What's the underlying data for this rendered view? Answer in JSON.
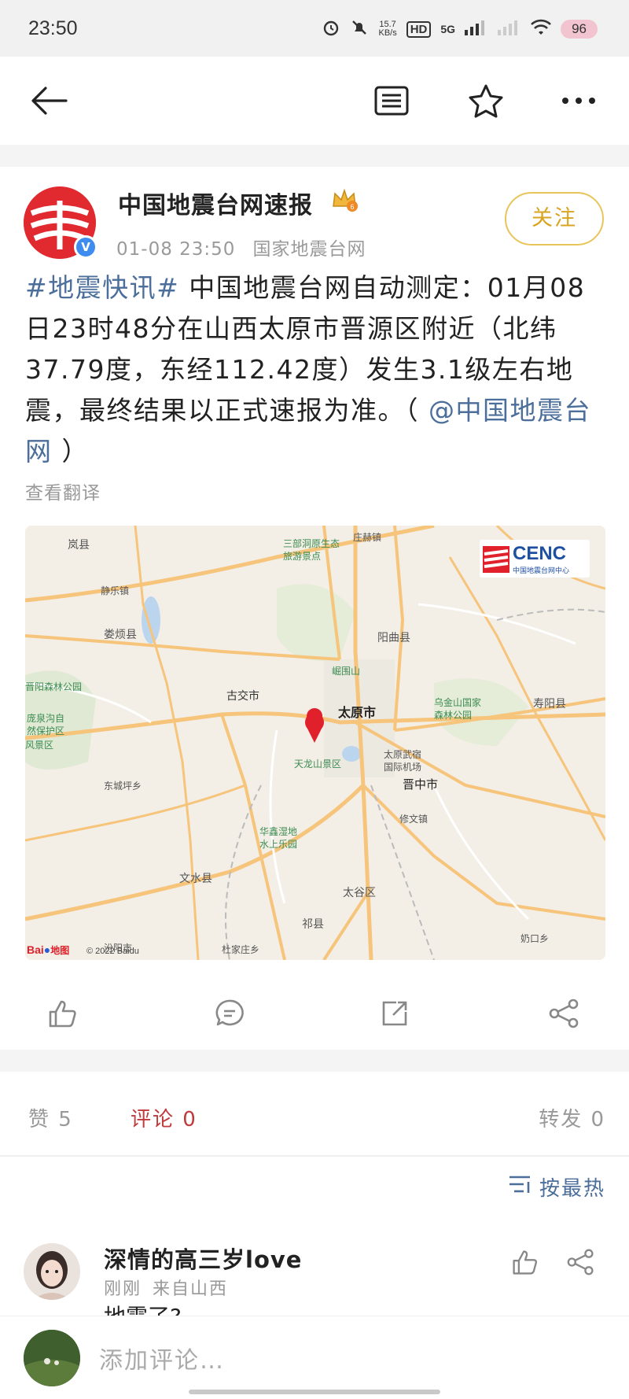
{
  "status_bar": {
    "time": "23:50",
    "net_speed_value": "15.7",
    "net_speed_unit": "KB/s",
    "hd_label": "HD",
    "hd_sub": "1",
    "network": "5G",
    "battery": "96",
    "icons": [
      "alarm-icon",
      "mute-icon",
      "signal-icon",
      "wifi-icon"
    ]
  },
  "nav": {
    "icons": [
      "back-arrow-icon",
      "article-list-icon",
      "star-icon",
      "more-icon"
    ]
  },
  "post": {
    "author": "中国地震台网速报",
    "time": "01-08 23:50",
    "source": "国家地震台网",
    "follow_label": "关注",
    "hashtag": "#地震快讯#",
    "body": " 中国地震台网自动测定：01月08日23时48分在山西太原市晋源区附近（北纬37.79度，东经112.42度）发生3.1级左右地震，最终结果以正式速报为准。（ ",
    "mention": "@中国地震台网",
    "body_end": " ）",
    "translate": "查看翻译"
  },
  "map": {
    "logo_text": "CENC",
    "logo_sub": "中国地震台网中心",
    "copyright": "© 2022 Baidu",
    "baidu_text": "Bai",
    "baidu_sub": "地图",
    "labels": {
      "lanxian": "岚县",
      "sanbu": "三部洞原生态",
      "sanbu2": "旅游景点",
      "zhuang": "庄赫镇",
      "jingle": "静乐镇",
      "loufan": "娄烦县",
      "yangqu": "阳曲县",
      "zhuoshan": "晋阳森林公园",
      "gujiaoshi": "古交市",
      "gushan": "崛围山",
      "taiyuan": "太原市",
      "wujin": "乌金山国家",
      "wujin2": "森林公园",
      "shouyang": "寿阳县",
      "pangquan": "庞泉沟自",
      "pangquan2": "然保护区",
      "fengjing": "风景区",
      "tianlong": "天龙山景区",
      "airport": "太原武宿",
      "airport2": "国际机场",
      "jinzhong": "晋中市",
      "dongcheng": "东城坪乡",
      "huaxin": "华鑫湿地",
      "huaxin2": "水上乐园",
      "yuci": "修文镇",
      "wenshui": "文水县",
      "taigu": "太谷区",
      "qixian": "祁县",
      "pingyao": "汾阳市",
      "ducun": "杜家庄乡",
      "xiaokou": "奶口乡"
    }
  },
  "actions": {
    "icons": [
      "like-icon",
      "comment-icon",
      "repost-icon",
      "share-icon"
    ]
  },
  "stats": {
    "like": "赞 5",
    "comment": "评论 0",
    "repost": "转发 0"
  },
  "sort_label": "按最热",
  "comment": {
    "user": "深情的高三岁love",
    "time": "刚刚",
    "location": "来自山西",
    "text_peek": "地震了?"
  },
  "input": {
    "placeholder": "添加评论…"
  }
}
